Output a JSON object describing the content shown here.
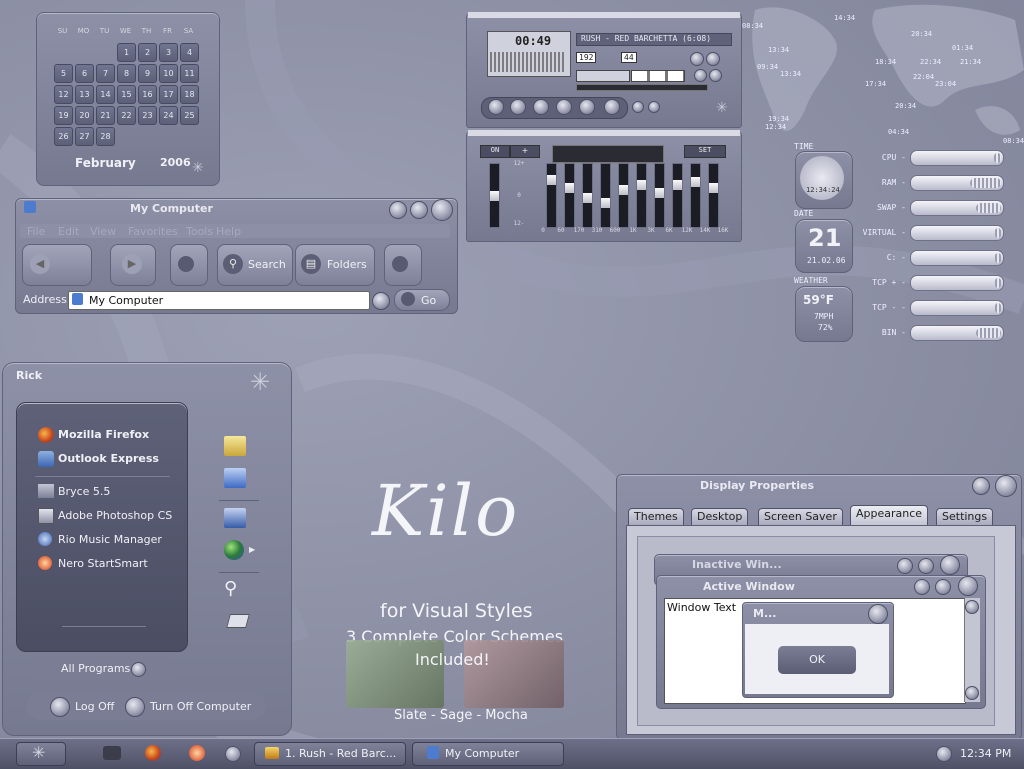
{
  "calendar": {
    "days": [
      "SU",
      "MO",
      "TU",
      "WE",
      "TH",
      "FR",
      "SA"
    ],
    "weeks": [
      [
        "",
        "",
        "",
        "1",
        "2",
        "3",
        "4"
      ],
      [
        "5",
        "6",
        "7",
        "8",
        "9",
        "10",
        "11"
      ],
      [
        "12",
        "13",
        "14",
        "15",
        "16",
        "17",
        "18"
      ],
      [
        "19",
        "20",
        "21",
        "22",
        "23",
        "24",
        "25"
      ],
      [
        "26",
        "27",
        "28",
        "",
        "",
        "",
        ""
      ]
    ],
    "month": "February",
    "year": "2006"
  },
  "mycomputer": {
    "title": "My Computer",
    "menu": [
      "File",
      "Edit",
      "View",
      "Favorites",
      "Tools",
      "Help"
    ],
    "search_label": "Search",
    "folders_label": "Folders",
    "address_label": "Address",
    "address_value": "My Computer",
    "go_label": "Go"
  },
  "player": {
    "track": "RUSH - RED BARCHETTA (6:08)",
    "time": "00:49",
    "kbps": "192",
    "khz": "44"
  },
  "eq": {
    "on_label": "ON",
    "auto_label": "+",
    "presets_label": "SET",
    "db_top": "12+",
    "db_mid": "0",
    "db_bot": "12-",
    "bands": [
      "0",
      "60",
      "170",
      "310",
      "600",
      "1K",
      "3K",
      "6K",
      "12K",
      "14K",
      "16K"
    ],
    "levels": [
      0.5,
      0.2,
      0.35,
      0.55,
      0.65,
      0.4,
      0.3,
      0.45,
      0.3,
      0.25,
      0.35,
      0.15
    ]
  },
  "worldclock": {
    "times": [
      "08:34",
      "14:34",
      "13:34",
      "20:34",
      "01:34",
      "09:34",
      "13:34",
      "18:34",
      "22:34",
      "21:34",
      "22:04",
      "23:04",
      "17:34",
      "20:34",
      "19:34",
      "04:34",
      "08:34",
      "12:34"
    ]
  },
  "widgets": {
    "time_label": "TIME",
    "clock_time": "12:34:24",
    "date_label": "DATE",
    "date_day": "21",
    "date_full": "21.02.06",
    "weather_label": "WEATHER",
    "temp": "59°F",
    "wind": "7MPH",
    "humidity": "72%"
  },
  "sysmon": [
    {
      "label": "CPU -",
      "level": 0.08
    },
    {
      "label": "RAM -",
      "level": 0.35
    },
    {
      "label": "SWAP -",
      "level": 0.28
    },
    {
      "label": "VIRTUAL -",
      "level": 0.06
    },
    {
      "label": "C: -",
      "level": 0.06
    },
    {
      "label": "TCP + -",
      "level": 0.06
    },
    {
      "label": "TCP - -",
      "level": 0.06
    },
    {
      "label": "BIN -",
      "level": 0.28
    }
  ],
  "startmenu": {
    "user": "Rick",
    "pinned": [
      "Mozilla Firefox",
      "Outlook Express"
    ],
    "recent": [
      "Bryce 5.5",
      "Adobe Photoshop CS",
      "Rio Music Manager",
      "Nero StartSmart"
    ],
    "all_programs": "All Programs",
    "logoff": "Log Off",
    "turnoff": "Turn Off Computer"
  },
  "brand": {
    "title": "Kilo",
    "subtitle": "for Visual Styles",
    "line1": "3 Complete Color Schemes",
    "line2": "Included!",
    "schemes": "Slate - Sage - Mocha"
  },
  "display": {
    "title": "Display Properties",
    "tabs": [
      "Themes",
      "Desktop",
      "Screen Saver",
      "Appearance",
      "Settings"
    ],
    "inactive_title": "Inactive Win...",
    "active_title": "Active Window",
    "window_text": "Window Text",
    "msg_title": "M...",
    "ok_label": "OK"
  },
  "taskbar": {
    "task1": "1. Rush - Red Barc...",
    "task2": "My Computer",
    "clock": "12:34 PM"
  }
}
